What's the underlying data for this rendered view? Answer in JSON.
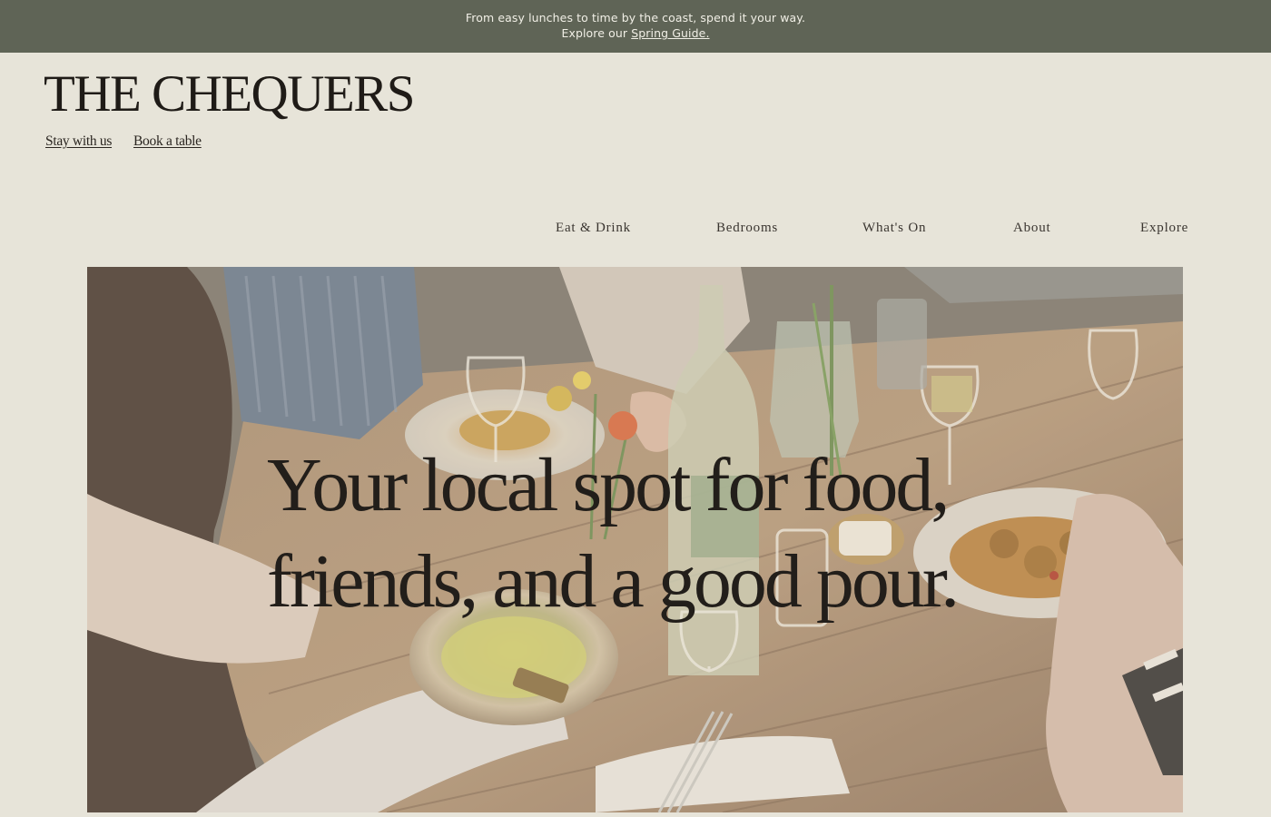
{
  "announcement": {
    "line1": "From easy lunches to time by the coast, spend it your way.",
    "line2_prefix": "Explore our",
    "link_text": "Spring Guide."
  },
  "header": {
    "logo_text": "THE CHEQUERS",
    "utility_links": {
      "stay": "Stay with us",
      "book": "Book a table"
    }
  },
  "nav": {
    "eat": "Eat & Drink",
    "bedrooms": "Bedrooms",
    "whats_on": "What's On",
    "about": "About",
    "explore": "Explore"
  },
  "hero": {
    "headline": "Your local spot for food, friends, and a good pour."
  },
  "colors": {
    "announcement_bg": "#5f6456",
    "page_bg": "#e7e4d9",
    "text": "#2a2520"
  }
}
